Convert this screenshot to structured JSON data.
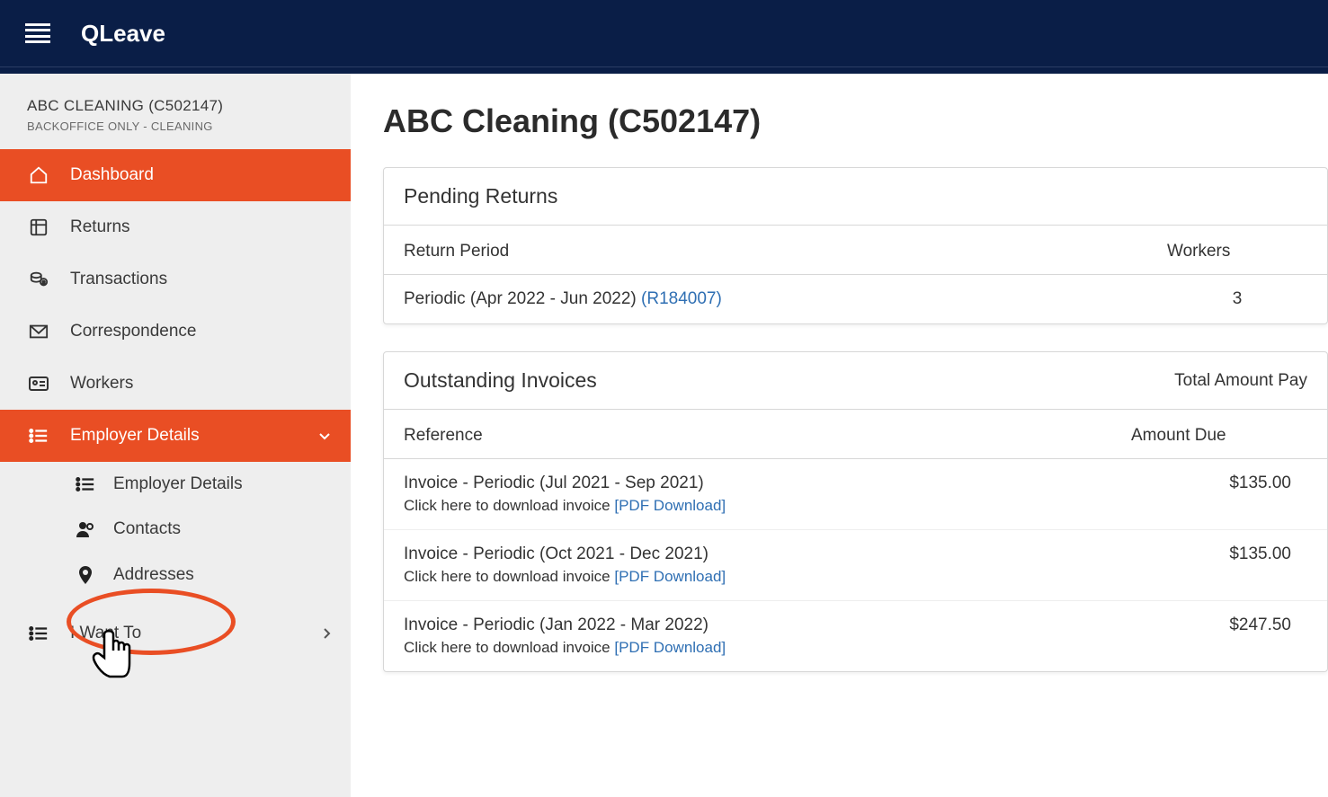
{
  "brand": "QLeave",
  "context": {
    "title": "ABC CLEANING (C502147)",
    "subtitle": "BACKOFFICE ONLY - CLEANING"
  },
  "nav": {
    "dashboard": "Dashboard",
    "returns": "Returns",
    "transactions": "Transactions",
    "correspondence": "Correspondence",
    "workers": "Workers",
    "employer_details": "Employer Details",
    "sub_employer_details": "Employer Details",
    "sub_contacts": "Contacts",
    "sub_addresses": "Addresses",
    "i_want_to": "I Want To"
  },
  "page": {
    "title": "ABC Cleaning (C502147)"
  },
  "pending_returns": {
    "header": "Pending Returns",
    "col_period": "Return Period",
    "col_workers": "Workers",
    "rows": [
      {
        "period_text": "Periodic (Apr 2022 - Jun 2022) ",
        "period_ref": "(R184007)",
        "workers": "3"
      }
    ]
  },
  "invoices": {
    "header": "Outstanding Invoices",
    "total_label": "Total Amount Pay",
    "col_reference": "Reference",
    "col_amount_due": "Amount Due",
    "dl_prefix": "Click here to download invoice ",
    "dl_link": "[PDF Download]",
    "rows": [
      {
        "ref": "Invoice - Periodic (Jul 2021 - Sep 2021)",
        "amount": "$135.00"
      },
      {
        "ref": "Invoice - Periodic (Oct 2021 - Dec 2021)",
        "amount": "$135.00"
      },
      {
        "ref": "Invoice - Periodic (Jan 2022 - Mar 2022)",
        "amount": "$247.50"
      }
    ]
  }
}
